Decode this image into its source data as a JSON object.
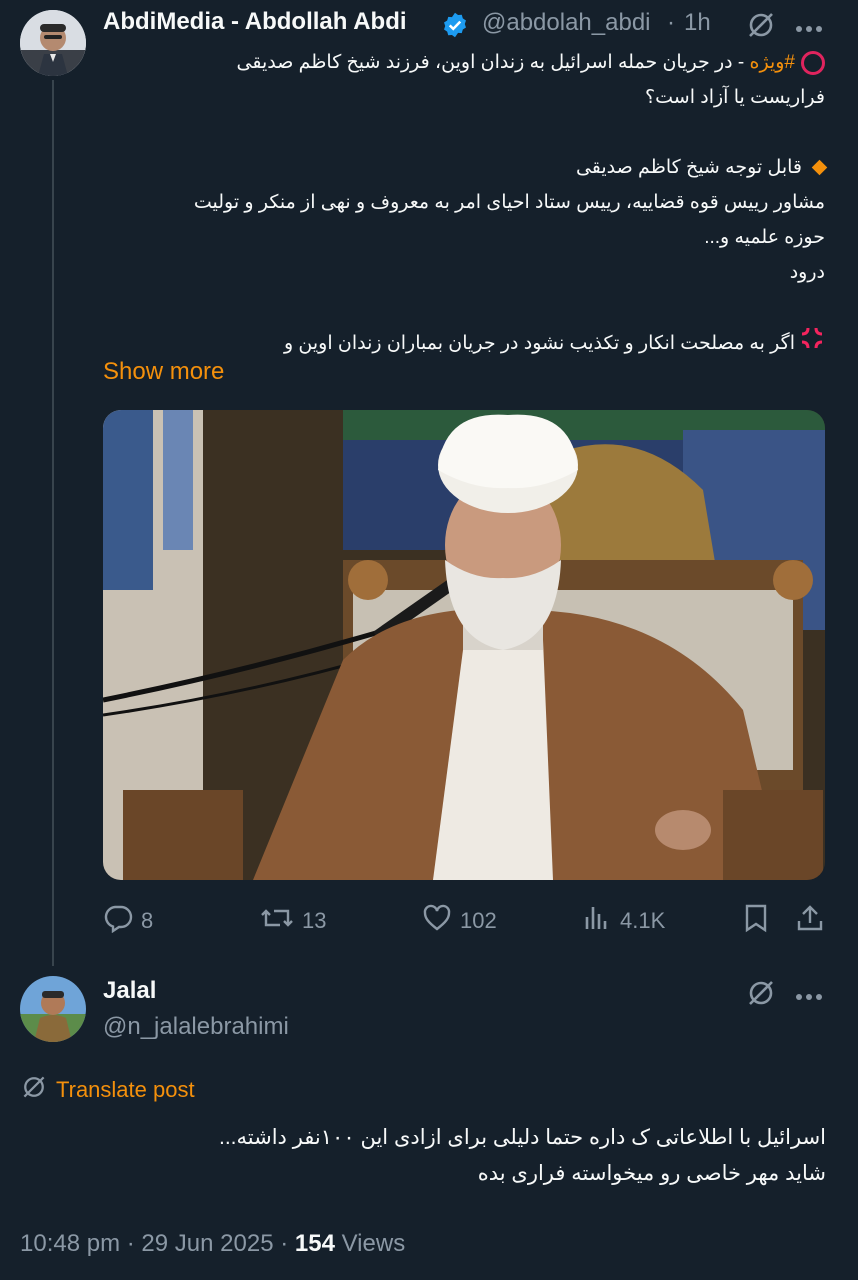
{
  "tweet": {
    "author_name": "AbdiMedia - Abdollah Abdi",
    "handle": "@abdolah_abdi",
    "separator": "·",
    "time": "1h",
    "hashtag": "#ویژه",
    "line1": "- در جریان حمله اسرائیل به زندان اوین، فرزند شیخ کاظم صدیقی",
    "line2": "فراریست یا آزاد است؟",
    "line3": "قابل توجه شیخ کاظم صدیقی",
    "line4": "مشاور رییس قوه قضاییه، رییس ستاد احیای امر به معروف و نهی از منکر و تولیت",
    "line5": "حوزه علمیه و...",
    "line6": "درود",
    "line7": "اگر به مصلحت انکار و تکذیب نشود در جریان بمباران زندان اوین و",
    "show_more": "Show more",
    "stats": {
      "replies": "8",
      "reposts": "13",
      "likes": "102",
      "views": "4.1K"
    }
  },
  "reply": {
    "author_name": "Jalal",
    "handle": "@n_jalalebrahimi",
    "translate": "Translate post",
    "line1": "اسرائیل با اطلاعاتی ک داره حتما دلیلی برای ازادی این ۱۰۰نفر داشته...",
    "line2": "شاید مهر خاصی رو میخواسته فراری بده",
    "time": "10:48 pm",
    "date": "29 Jun 2025",
    "views_count": "154",
    "views_label": "Views"
  },
  "colors": {
    "background": "#15202b",
    "accent": "#f4900c",
    "muted": "#8b98a5",
    "verified": "#1d9bf0"
  },
  "icons": [
    "grok-icon",
    "more-icon",
    "verified-badge-icon",
    "red-circle-icon",
    "orange-diamond-icon",
    "anger-icon",
    "reply-icon",
    "repost-icon",
    "like-icon",
    "views-icon",
    "bookmark-icon",
    "share-icon",
    "translate-icon"
  ]
}
